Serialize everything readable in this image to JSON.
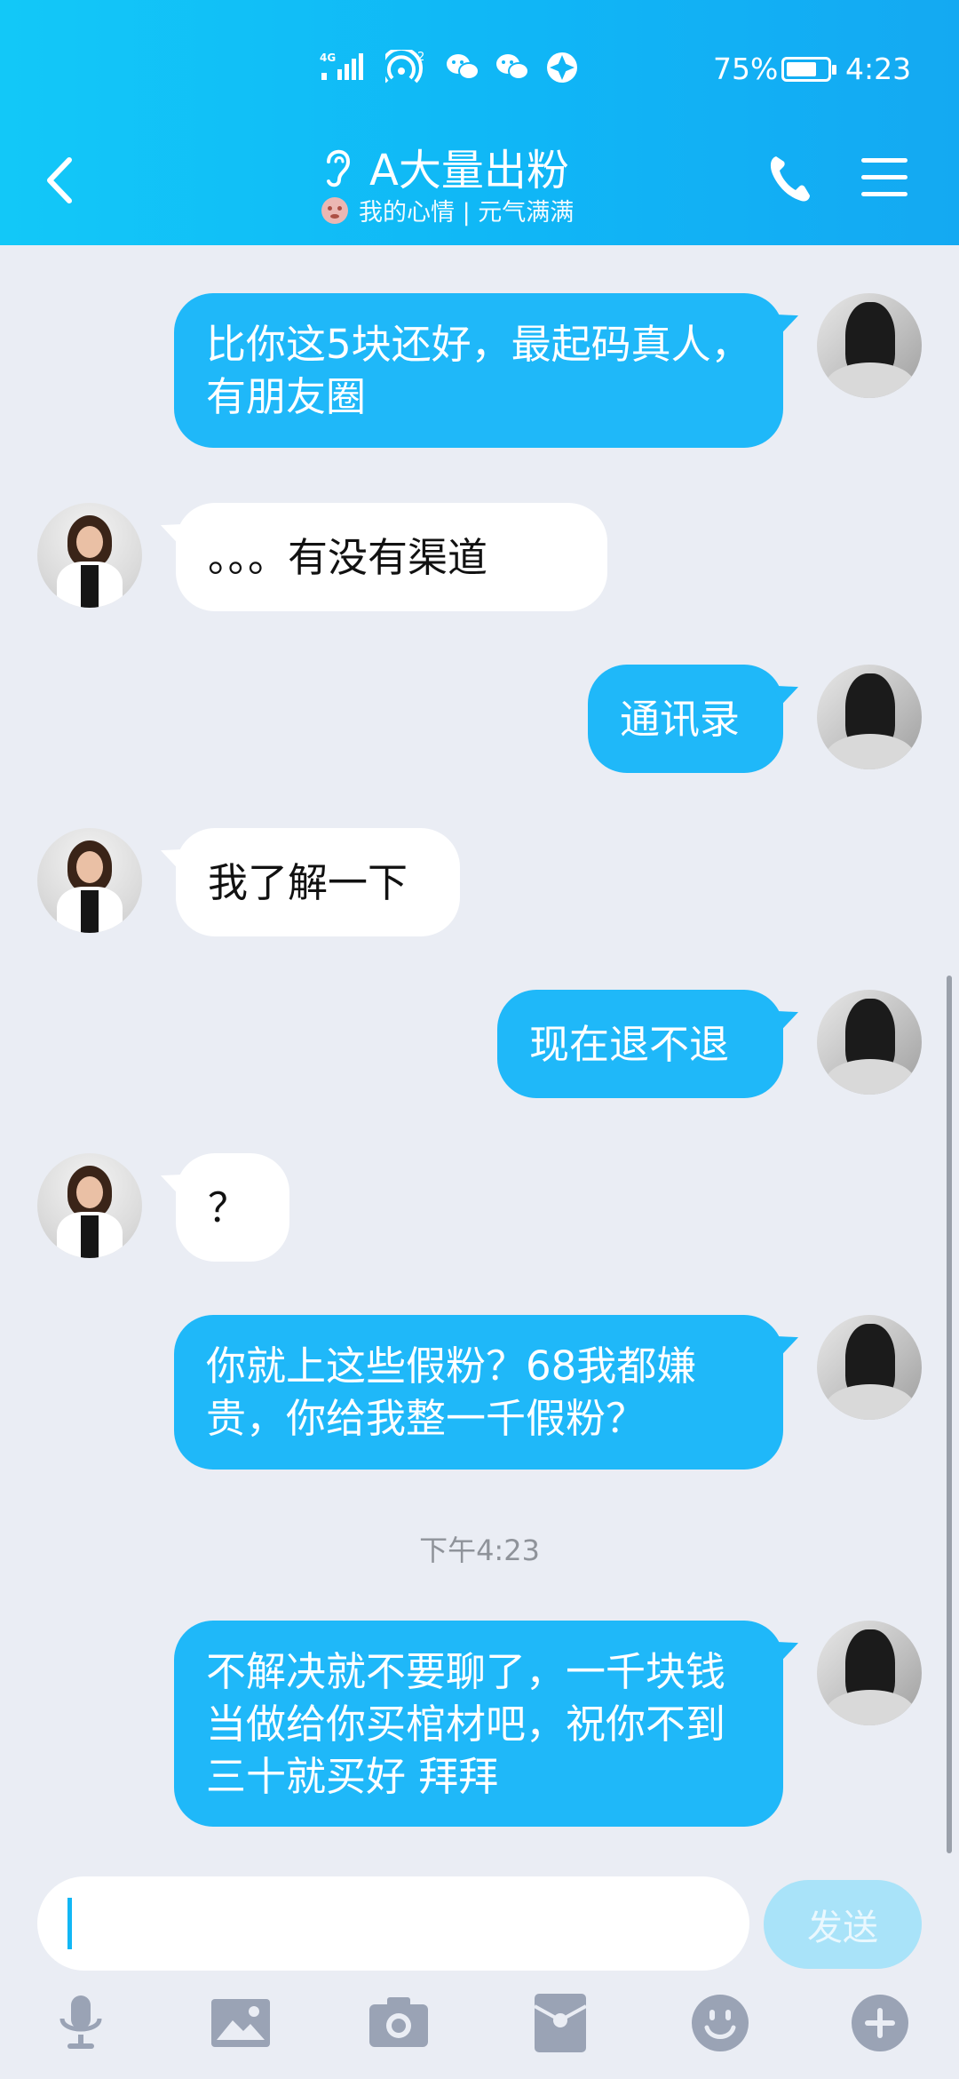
{
  "status_bar": {
    "network_label": "4G",
    "hotspot_badge": "2",
    "battery_percent": "75%",
    "battery_level": 0.75,
    "time": "4:23"
  },
  "header": {
    "title": "A大量出粉",
    "subtitle": "我的心情 | 元气满满"
  },
  "messages": [
    {
      "sender": "self",
      "text": "比你这5块还好，最起码真人，有朋友圈"
    },
    {
      "sender": "other",
      "text": "。。。有没有渠道"
    },
    {
      "sender": "self",
      "text": "通讯录"
    },
    {
      "sender": "other",
      "text": "我了解一下"
    },
    {
      "sender": "self",
      "text": "现在退不退"
    },
    {
      "sender": "other",
      "text": "？"
    },
    {
      "sender": "self",
      "text": "你就上这些假粉？68我都嫌贵，你给我整一千假粉？"
    },
    {
      "sender": "self",
      "text": "不解决就不要聊了，一千块钱当做给你买棺材吧，祝你不到三十就买好 拜拜"
    }
  ],
  "timestamp": "下午4:23",
  "input": {
    "value": "",
    "send_label": "发送"
  },
  "toolbar_icons": [
    "microphone-icon",
    "image-icon",
    "camera-icon",
    "red-packet-icon",
    "emoji-icon",
    "plus-icon"
  ],
  "colors": {
    "header_start": "#12c8f8",
    "header_end": "#14a9f2",
    "self_bubble": "#1fb8f9",
    "other_bubble": "#ffffff",
    "background": "#eaedf4",
    "send_button_disabled": "#a9e3f9",
    "toolbar_icon": "#9aa3b5"
  }
}
